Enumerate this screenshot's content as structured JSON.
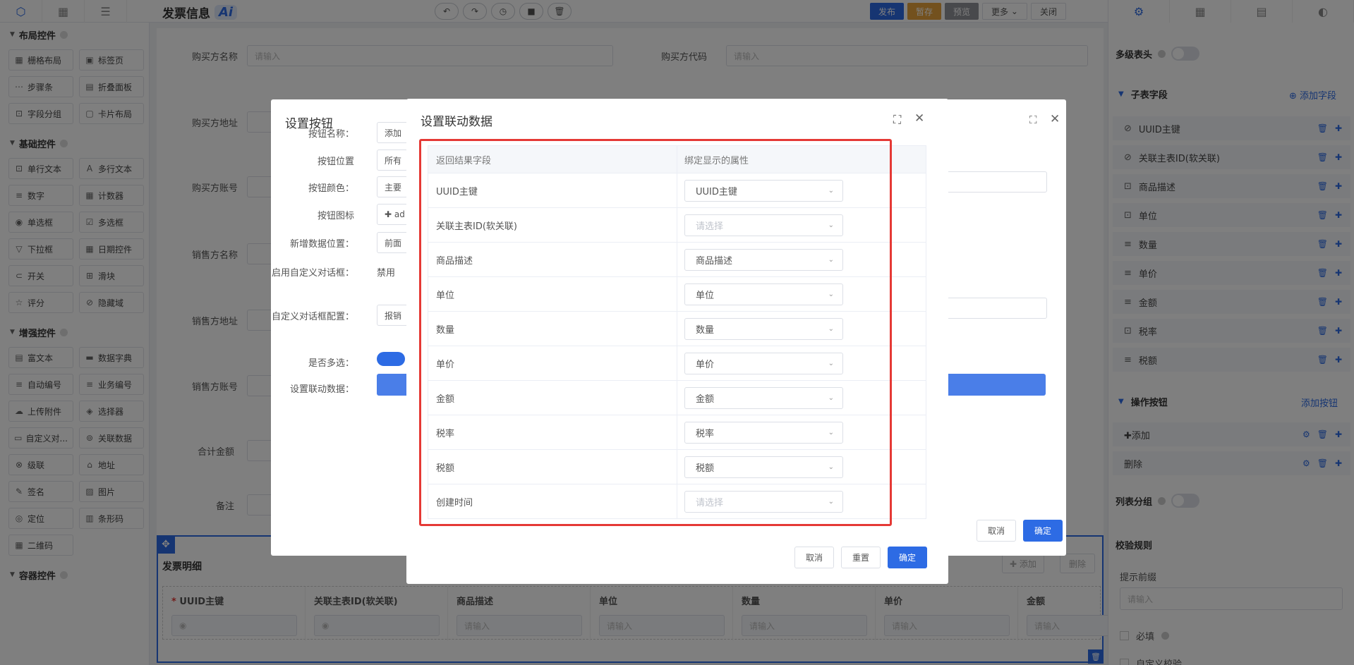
{
  "header": {
    "title": "发票信息",
    "ai_badge": "Ai",
    "actions": {
      "publish": "发布",
      "draft": "暂存",
      "preview": "预览",
      "more": "更多",
      "close": "关闭"
    },
    "colors": {
      "publish": "#2d6be4",
      "draft": "#e6a23c",
      "preview": "#909399",
      "more": "#a0a4aa",
      "close": "#ffffff"
    }
  },
  "left_panel": {
    "sections": [
      {
        "title": "布局控件",
        "items": [
          {
            "icon": "grid-layout-icon",
            "label": "栅格布局"
          },
          {
            "icon": "tab-page-icon",
            "label": "标签页"
          },
          {
            "icon": "steps-icon",
            "label": "步骤条"
          },
          {
            "icon": "collapse-panel-icon",
            "label": "折叠面板"
          },
          {
            "icon": "field-group-icon",
            "label": "字段分组"
          },
          {
            "icon": "card-layout-icon",
            "label": "卡片布局"
          }
        ]
      },
      {
        "title": "基础控件",
        "items": [
          {
            "icon": "single-text-icon",
            "label": "单行文本"
          },
          {
            "icon": "multi-text-icon",
            "label": "多行文本"
          },
          {
            "icon": "number-icon",
            "label": "数字"
          },
          {
            "icon": "counter-icon",
            "label": "计数器"
          },
          {
            "icon": "radio-icon",
            "label": "单选框"
          },
          {
            "icon": "checkbox-icon",
            "label": "多选框"
          },
          {
            "icon": "dropdown-icon",
            "label": "下拉框"
          },
          {
            "icon": "date-icon",
            "label": "日期控件"
          },
          {
            "icon": "switch-icon",
            "label": "开关"
          },
          {
            "icon": "slider-icon",
            "label": "滑块"
          },
          {
            "icon": "rating-icon",
            "label": "评分"
          },
          {
            "icon": "hidden-field-icon",
            "label": "隐藏域"
          }
        ]
      },
      {
        "title": "增强控件",
        "items": [
          {
            "icon": "rich-text-icon",
            "label": "富文本"
          },
          {
            "icon": "dictionary-icon",
            "label": "数据字典"
          },
          {
            "icon": "auto-number-icon",
            "label": "自动编号"
          },
          {
            "icon": "business-number-icon",
            "label": "业务编号"
          },
          {
            "icon": "upload-icon",
            "label": "上传附件"
          },
          {
            "icon": "selector-icon",
            "label": "选择器"
          },
          {
            "icon": "custom-dialog-icon",
            "label": "自定义对..."
          },
          {
            "icon": "related-data-icon",
            "label": "关联数据"
          },
          {
            "icon": "cascade-icon",
            "label": "级联"
          },
          {
            "icon": "address-icon",
            "label": "地址"
          },
          {
            "icon": "signature-icon",
            "label": "签名"
          },
          {
            "icon": "image-icon",
            "label": "图片"
          },
          {
            "icon": "location-icon",
            "label": "定位"
          },
          {
            "icon": "barcode-icon",
            "label": "条形码"
          },
          {
            "icon": "qrcode-icon",
            "label": "二维码"
          }
        ]
      },
      {
        "title": "容器控件",
        "items": []
      }
    ]
  },
  "form": {
    "placeholder": "请输入",
    "rows": [
      {
        "label": "购买方名称",
        "label2": "购买方代码"
      },
      {
        "label": "购买方地址"
      },
      {
        "label": "购买方账号"
      },
      {
        "label": "销售方名称"
      },
      {
        "label": "销售方地址"
      },
      {
        "label": "销售方账号"
      },
      {
        "label": "合计金额"
      },
      {
        "label": "备注"
      }
    ],
    "subtable": {
      "title": "发票明细",
      "add": "✚ 添加",
      "delete": "删除",
      "columns": [
        "UUID主键",
        "关联主表ID(软关联)",
        "商品描述",
        "单位",
        "数量",
        "单价",
        "金额"
      ]
    }
  },
  "button_dialog": {
    "title": "设置按钮",
    "fields": [
      {
        "label": "按钮名称：",
        "value": "添加"
      },
      {
        "label": "按钮位置",
        "value": "所有"
      },
      {
        "label": "按钮颜色：",
        "value": "主要"
      },
      {
        "label": "按钮图标",
        "value": "✚ ad"
      },
      {
        "label": "新增数据位置：",
        "value": "前面"
      },
      {
        "label": "启用自定义对话框：",
        "value": "禁用"
      },
      {
        "label": "自定义对话框配置：",
        "value": "报销"
      },
      {
        "label": "是否多选："
      },
      {
        "label": "设置联动数据："
      }
    ],
    "cancel": "取消",
    "confirm": "确定"
  },
  "linkage_dialog": {
    "title": "设置联动数据",
    "columns": {
      "result_field": "返回结果字段",
      "bind_attr": "绑定显示的属性"
    },
    "rows": [
      {
        "field": "UUID主键",
        "value": "UUID主键",
        "placeholder": false
      },
      {
        "field": "关联主表ID(软关联)",
        "value": "请选择",
        "placeholder": true
      },
      {
        "field": "商品描述",
        "value": "商品描述",
        "placeholder": false
      },
      {
        "field": "单位",
        "value": "单位",
        "placeholder": false
      },
      {
        "field": "数量",
        "value": "数量",
        "placeholder": false
      },
      {
        "field": "单价",
        "value": "单价",
        "placeholder": false
      },
      {
        "field": "金额",
        "value": "金额",
        "placeholder": false
      },
      {
        "field": "税率",
        "value": "税率",
        "placeholder": false
      },
      {
        "field": "税额",
        "value": "税额",
        "placeholder": false
      },
      {
        "field": "创建时间",
        "value": "请选择",
        "placeholder": true
      }
    ],
    "buttons": {
      "cancel": "取消",
      "reset": "重置",
      "confirm": "确定"
    },
    "highlight_color": "#e53935"
  },
  "right_panel": {
    "multi_header": "多级表头",
    "sub_fields_title": "子表字段",
    "add_field": "⊕ 添加字段",
    "sub_fields": [
      {
        "icon": "eye-off-icon",
        "label": "UUID主键"
      },
      {
        "icon": "eye-off-icon",
        "label": "关联主表ID(软关联)"
      },
      {
        "icon": "text-field-icon",
        "label": "商品描述"
      },
      {
        "icon": "text-field-icon",
        "label": "单位"
      },
      {
        "icon": "number-field-icon",
        "label": "数量"
      },
      {
        "icon": "number-field-icon",
        "label": "单价"
      },
      {
        "icon": "number-field-icon",
        "label": "金额"
      },
      {
        "icon": "text-field-icon",
        "label": "税率"
      },
      {
        "icon": "number-field-icon",
        "label": "税额"
      }
    ],
    "ops_title": "操作按钮",
    "add_button": "添加按钮",
    "ops": [
      {
        "label": "✚添加"
      },
      {
        "label": "删除"
      }
    ],
    "list_group": "列表分组",
    "validation": "校验规则",
    "hint_label": "提示前缀",
    "hint_placeholder": "请输入",
    "required": "必填",
    "custom_validation": "自定义校验"
  }
}
